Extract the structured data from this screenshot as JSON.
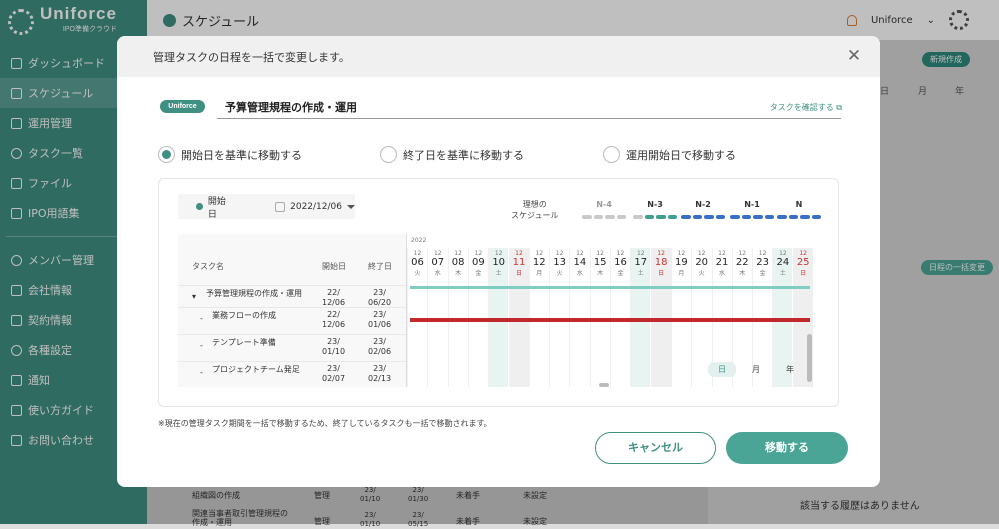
{
  "app": {
    "logo": "Uniforce",
    "logo_sub": "IPO準備クラウド",
    "page_title": "スケジュール",
    "user": "Uniforce"
  },
  "sidebar": {
    "items": [
      {
        "label": "ダッシュボード"
      },
      {
        "label": "スケジュール"
      },
      {
        "label": "運用管理"
      },
      {
        "label": "タスク一覧"
      },
      {
        "label": "ファイル"
      },
      {
        "label": "IPO用語集"
      }
    ],
    "items2": [
      {
        "label": "メンバー管理"
      },
      {
        "label": "会社情報"
      },
      {
        "label": "契約情報"
      },
      {
        "label": "各種設定"
      },
      {
        "label": "通知"
      },
      {
        "label": "使い方ガイド"
      },
      {
        "label": "お問い合わせ"
      }
    ]
  },
  "background": {
    "new_btn": "新規作成",
    "tab_day": "日",
    "tab_month": "月",
    "tab_year": "年",
    "bulk_btn": "日程の一括変更",
    "no_history": "該当する履歴はありません",
    "rows": [
      {
        "name": "組織図の作成",
        "cat": "管理",
        "start": "23/\n01/10",
        "end": "23/\n01/30",
        "status": "未着手",
        "setting": "未設定"
      },
      {
        "name": "関連当事者取引管理規程の作成・運用",
        "cat": "管理",
        "start": "23/\n01/10",
        "end": "23/\n05/15",
        "status": "未着手",
        "setting": "未設定"
      }
    ]
  },
  "modal": {
    "heading": "管理タスクの日程を一括で変更します。",
    "badge": "Uniforce",
    "task_title": "予算管理規程の作成・運用",
    "confirm_link": "タスクを確認する",
    "radios": [
      {
        "label": "開始日を基準に移動する",
        "selected": true
      },
      {
        "label": "終了日を基準に移動する",
        "selected": false
      },
      {
        "label": "運用開始日で移動する",
        "selected": false
      }
    ],
    "start_label": "開始日",
    "start_date": "2022/12/06",
    "ideal_label": "理想の\nスケジュール",
    "milestones": [
      "N-4",
      "N-3",
      "N-2",
      "N-1",
      "N"
    ],
    "year": "2022",
    "table_headers": {
      "name": "タスク名",
      "start": "開始日",
      "end": "終了日"
    },
    "tasks": [
      {
        "name": "予算管理規程の作成・運用",
        "start": "22/\n12/06",
        "end": "23/\n06/20",
        "parent": true
      },
      {
        "name": "業務フローの作成",
        "start": "22/\n12/06",
        "end": "23/\n01/06",
        "parent": false
      },
      {
        "name": "テンプレート準備",
        "start": "23/\n01/10",
        "end": "23/\n02/06",
        "parent": false
      },
      {
        "name": "プロジェクトチーム発足",
        "start": "23/\n02/07",
        "end": "23/\n02/13",
        "parent": false
      }
    ],
    "days": [
      {
        "m": "12",
        "d": "06",
        "w": "火",
        "t": ""
      },
      {
        "m": "12",
        "d": "07",
        "w": "水",
        "t": ""
      },
      {
        "m": "12",
        "d": "08",
        "w": "木",
        "t": ""
      },
      {
        "m": "12",
        "d": "09",
        "w": "金",
        "t": ""
      },
      {
        "m": "12",
        "d": "10",
        "w": "土",
        "t": "today"
      },
      {
        "m": "12",
        "d": "11",
        "w": "日",
        "t": "we"
      },
      {
        "m": "12",
        "d": "12",
        "w": "月",
        "t": ""
      },
      {
        "m": "12",
        "d": "13",
        "w": "火",
        "t": ""
      },
      {
        "m": "12",
        "d": "14",
        "w": "水",
        "t": ""
      },
      {
        "m": "12",
        "d": "15",
        "w": "木",
        "t": ""
      },
      {
        "m": "12",
        "d": "16",
        "w": "金",
        "t": ""
      },
      {
        "m": "12",
        "d": "17",
        "w": "土",
        "t": "today"
      },
      {
        "m": "12",
        "d": "18",
        "w": "日",
        "t": "we"
      },
      {
        "m": "12",
        "d": "19",
        "w": "月",
        "t": ""
      },
      {
        "m": "12",
        "d": "20",
        "w": "火",
        "t": ""
      },
      {
        "m": "12",
        "d": "21",
        "w": "水",
        "t": ""
      },
      {
        "m": "12",
        "d": "22",
        "w": "木",
        "t": ""
      },
      {
        "m": "12",
        "d": "23",
        "w": "金",
        "t": ""
      },
      {
        "m": "12",
        "d": "24",
        "w": "土",
        "t": "today"
      },
      {
        "m": "12",
        "d": "25",
        "w": "日",
        "t": "we"
      }
    ],
    "scale": [
      "日",
      "月",
      "年"
    ],
    "note": "※現在の管理タスク期間を一括で移動するため、終了しているタスクも一括で移動されます。",
    "cancel": "キャンセル",
    "move": "移動する"
  },
  "colors": {
    "accent": "#3f8f82",
    "bar_teal": "#7fcdc3",
    "bar_red": "#c0282a",
    "milestone_gray": "#c9c9c9",
    "milestone_blue": "#3a6fc9"
  }
}
